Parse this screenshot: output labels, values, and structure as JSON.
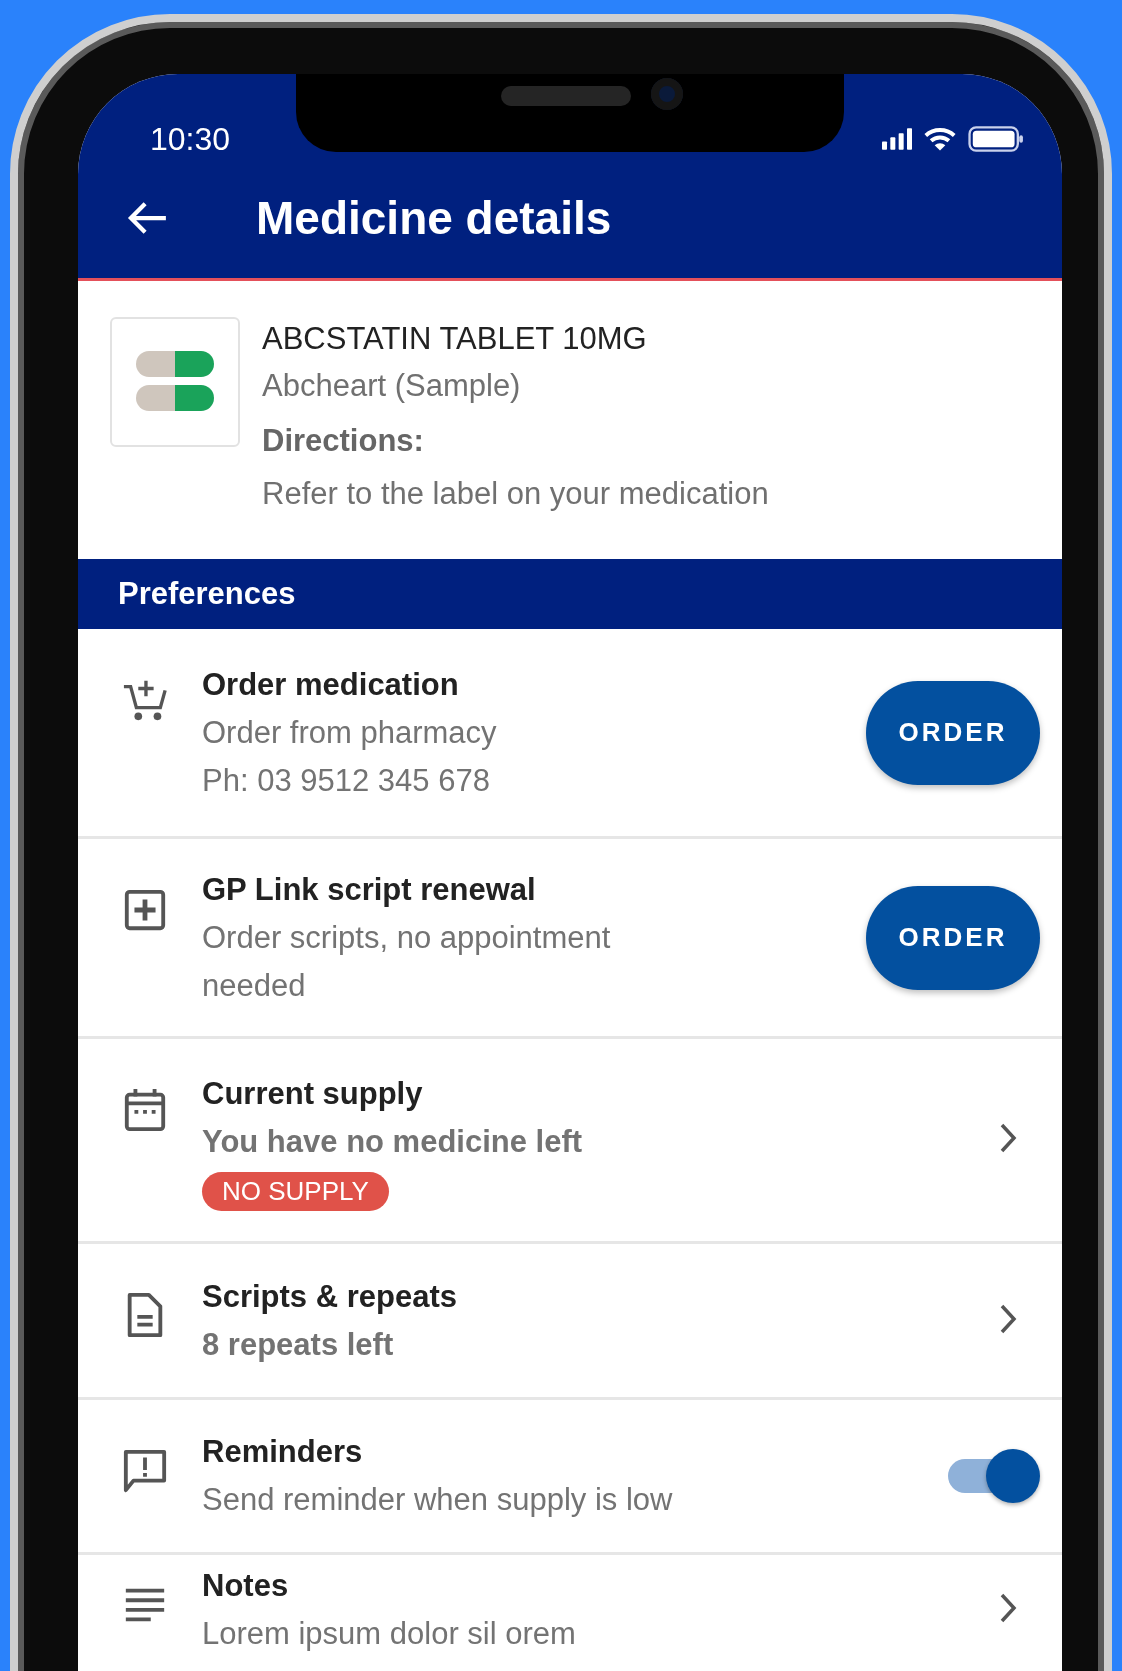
{
  "status_bar": {
    "time": "10:30"
  },
  "header": {
    "title": "Medicine details"
  },
  "medicine": {
    "name": "ABCSTATIN TABLET 10MG",
    "brand": "Abcheart (Sample)",
    "directions_label": "Directions:",
    "directions": "Refer to the label on your medication"
  },
  "section_title": "Preferences",
  "items": [
    {
      "kind": "button",
      "title": "Order medication",
      "lines": [
        "Order from pharmacy",
        "Ph: 03 9512 345 678"
      ],
      "bold": false,
      "button": "ORDER"
    },
    {
      "kind": "button",
      "title": "GP Link script renewal",
      "lines": [
        "Order scripts, no appointment needed"
      ],
      "bold": false,
      "button": "ORDER"
    },
    {
      "kind": "chevron",
      "title": "Current supply",
      "lines": [
        "You have no medicine left"
      ],
      "bold": true,
      "badge": "NO SUPPLY"
    },
    {
      "kind": "chevron",
      "title": "Scripts & repeats",
      "lines": [
        "8 repeats left"
      ],
      "bold": true
    },
    {
      "kind": "toggle",
      "title": "Reminders",
      "lines": [
        "Send reminder when supply is low"
      ],
      "bold": false,
      "on": true
    },
    {
      "kind": "chevron",
      "title": "Notes",
      "lines": [
        "Lorem ipsum dolor sil orem"
      ],
      "bold": false
    }
  ]
}
